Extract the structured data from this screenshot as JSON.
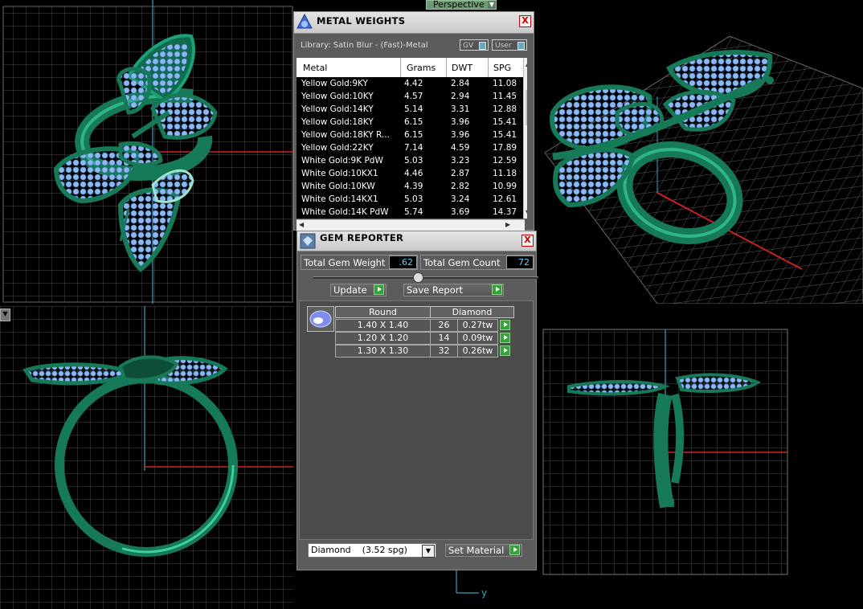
{
  "viewport": {
    "perspective_label": "Perspective",
    "axis_label_y": "y"
  },
  "colors": {
    "ring_green": "#1a8a64",
    "ring_dark": "#0e5a40",
    "gem_blue": "#8fb6f5",
    "grid": "#4d4d4d",
    "axis_red": "#cc2020",
    "axis_blue": "#3aa0c0"
  },
  "metal_weights": {
    "title": "METAL WEIGHTS",
    "close_label": "X",
    "library_label": "Library: Satin Blur - (Fast)-Metal",
    "gv_label": "GV",
    "user_label": "User",
    "columns": [
      "Metal",
      "Grams",
      "DWT",
      "SPG"
    ],
    "rows": [
      [
        "Yellow Gold:9KY",
        "4.42",
        "2.84",
        "11.08"
      ],
      [
        "Yellow Gold:10KY",
        "4.57",
        "2.94",
        "11.45"
      ],
      [
        "Yellow Gold:14KY",
        "5.14",
        "3.31",
        "12.88"
      ],
      [
        "Yellow Gold:18KY",
        "6.15",
        "3.96",
        "15.41"
      ],
      [
        "Yellow Gold:18KY R...",
        "6.15",
        "3.96",
        "15.41"
      ],
      [
        "Yellow Gold:22KY",
        "7.14",
        "4.59",
        "17.89"
      ],
      [
        "White Gold:9K PdW",
        "5.03",
        "3.23",
        "12.59"
      ],
      [
        "White Gold:10KX1",
        "4.46",
        "2.87",
        "11.18"
      ],
      [
        "White Gold:10KW",
        "4.39",
        "2.82",
        "10.99"
      ],
      [
        "White Gold:14KX1",
        "5.03",
        "3.24",
        "12.61"
      ],
      [
        "White Gold:14K PdW",
        "5.74",
        "3.69",
        "14.37"
      ]
    ]
  },
  "gem_reporter": {
    "title": "GEM REPORTER",
    "close_label": "X",
    "total_weight_label": "Total Gem Weight",
    "total_weight_value": ".62",
    "total_count_label": "Total Gem Count",
    "total_count_value": "72",
    "update_label": "Update",
    "save_report_label": "Save Report",
    "shape_header": "Round",
    "material_header": "Diamond",
    "gems": [
      {
        "size": "1.40 X 1.40",
        "count": "26",
        "weight": "0.27tw"
      },
      {
        "size": "1.20 X 1.20",
        "count": "14",
        "weight": "0.09tw"
      },
      {
        "size": "1.30 X 1.30",
        "count": "32",
        "weight": "0.26tw"
      }
    ],
    "material_select": "Diamond    (3.52 spg)",
    "set_material_label": "Set Material"
  }
}
